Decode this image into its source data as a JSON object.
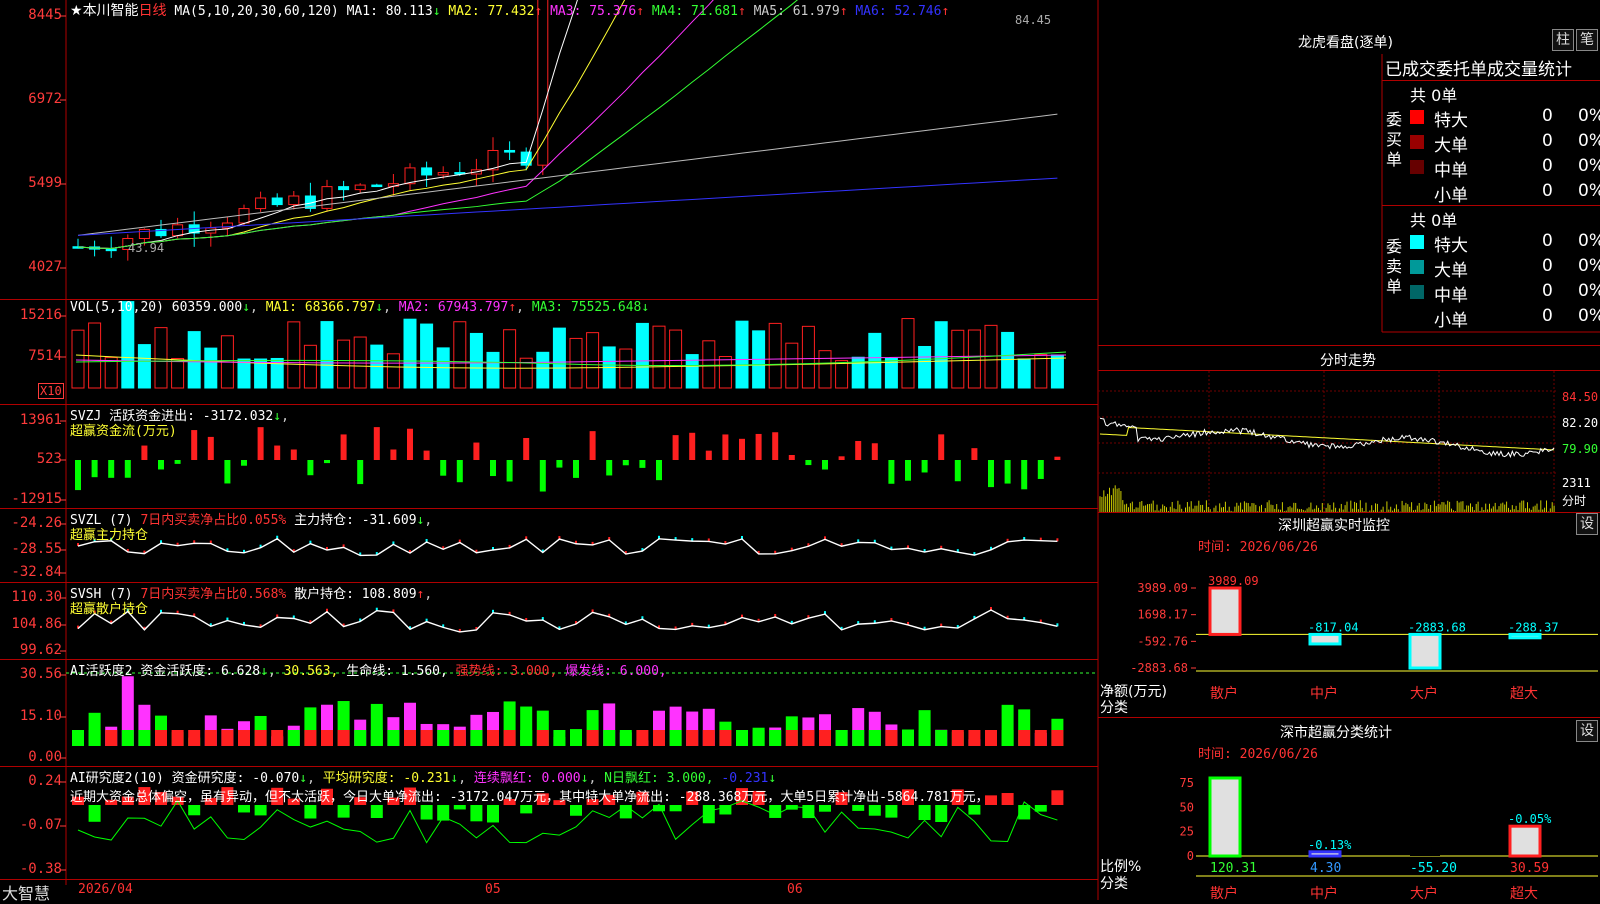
{
  "app_name": "大智慧",
  "stock": {
    "name": "本川智能",
    "period": "日线"
  },
  "main_panel": {
    "ma_header": "MA(5,10,20,30,60,120)",
    "ma": [
      {
        "label": "MA1: 80.113",
        "arrow": "↓",
        "color": "#ffffff"
      },
      {
        "label": "MA2: 77.432",
        "arrow": "↑",
        "color": "#ffff33"
      },
      {
        "label": "MA3: 75.376",
        "arrow": "↑",
        "color": "#ff33ff"
      },
      {
        "label": "MA4: 71.681",
        "arrow": "↑",
        "color": "#33ff33"
      },
      {
        "label": "MA5: 61.979",
        "arrow": "↑",
        "color": "#cccccc"
      },
      {
        "label": "MA6: 52.746",
        "arrow": "↑",
        "color": "#3333ff"
      }
    ],
    "y_ticks": [
      "8445",
      "6972",
      "5499",
      "4027"
    ],
    "high_mark": "84.45",
    "low_mark": "43.94"
  },
  "vol_panel": {
    "header": "VOL(5,10,20)",
    "value": "60359.000",
    "ma1": "MA1: 68366.797",
    "ma2": "MA2: 67943.797",
    "ma3": "MA3: 75525.648",
    "y_ticks": [
      "15216",
      "7514"
    ],
    "unit": "X10"
  },
  "svzj_panel": {
    "header": "SVZJ",
    "text": "活跃资金进出: -3172.032",
    "subtitle": "超赢资金流(万元)",
    "y_ticks": [
      "13961",
      "523",
      "-12915"
    ]
  },
  "svzl_panel": {
    "header": "SVZL (7)",
    "text1": "7日内买卖净占比0.055%",
    "text2": "主力持仓: -31.609",
    "subtitle": "超赢主力持仓",
    "y_ticks": [
      "-24.26",
      "-28.55",
      "-32.84"
    ]
  },
  "svsh_panel": {
    "header": "SVSH (7)",
    "text1": "7日内买卖净占比0.568%",
    "text2": "散户持仓: 108.809",
    "subtitle": "超赢散户持仓",
    "y_ticks": [
      "110.30",
      "104.86",
      "99.62"
    ]
  },
  "ai1_panel": {
    "header": "AI活跃度2",
    "t1": "资金活跃度: 6.628",
    "t2": "30.563,",
    "t3": "生命线: 1.560,",
    "t4": "强势线: 3.000,",
    "t5": "爆发线: 6.000,",
    "y_ticks": [
      "30.56",
      "15.10",
      "0.00"
    ]
  },
  "ai2_panel": {
    "header": "AI研究度2(10)",
    "t1": "资金研究度: -0.070",
    "t2": "平均研究度: -0.231",
    "t3": "连续飘红: 0.000",
    "t4": "N日飘红: 3.000,",
    "t5": "-0.231",
    "summary": "近期大资金总体偏空，虽有异动，但不太活跃，今日大单净流出: -3172.047万元，其中特大单净流出: -288.368万元，大单5日累计净出-5864.781万元，",
    "y_ticks": [
      "0.24",
      "-0.07",
      "-0.38"
    ]
  },
  "x_axis": [
    "2026/04",
    "05",
    "06"
  ],
  "right": {
    "lhkp_title": "龙虎看盘(逐单)",
    "btn_zhu": "柱",
    "btn_bi": "笔",
    "order_tabs": "已成交委托单成交量统计",
    "buy_label": "委买单",
    "sell_label": "委卖单",
    "buy_total": "共 0单",
    "sell_total": "共 0单",
    "buy_rows": [
      {
        "name": "特大",
        "val": "0",
        "pct": "0%",
        "color": "#ff0000"
      },
      {
        "name": "大单",
        "val": "0",
        "pct": "0%",
        "color": "#990000"
      },
      {
        "name": "中单",
        "val": "0",
        "pct": "0%",
        "color": "#660000"
      },
      {
        "name": "小单",
        "val": "0",
        "pct": "0%",
        "color": ""
      }
    ],
    "sell_rows": [
      {
        "name": "特大",
        "val": "0",
        "pct": "0%",
        "color": "#00ffff"
      },
      {
        "name": "大单",
        "val": "0",
        "pct": "0%",
        "color": "#009999"
      },
      {
        "name": "中单",
        "val": "0",
        "pct": "0%",
        "color": "#006666"
      },
      {
        "name": "小单",
        "val": "0",
        "pct": "0%",
        "color": ""
      }
    ],
    "fenshi_title": "分时走势",
    "fenshi_y": [
      "84.50",
      "82.20",
      "79.90",
      "2311",
      "分时"
    ],
    "monitor_title": "深圳超赢实时监控",
    "monitor_btn": "设",
    "monitor_time": "时间: 2026/06/26",
    "monitor_y": [
      "3989.09",
      "1698.17",
      "-592.76",
      "-2883.68"
    ],
    "monitor_ylabel": "净额(万元)",
    "monitor_xlabel": "分类",
    "classify_title": "深市超赢分类统计",
    "classify_btn": "设",
    "classify_time": "时间: 2026/06/26",
    "classify_y": [
      "75",
      "50",
      "25",
      "0"
    ],
    "classify_ylabel": "比例%",
    "classify_xlabel": "分类"
  },
  "chart_data": [
    {
      "type": "bar",
      "title": "深圳超赢实时监控",
      "ylabel": "净额(万元)",
      "categories": [
        "散户",
        "中户",
        "大户",
        "超大"
      ],
      "values": [
        3989.09,
        -817.04,
        -2883.68,
        -288.37
      ],
      "ylim": [
        -2883.68,
        3989.09
      ]
    },
    {
      "type": "bar",
      "title": "深市超赢分类统计",
      "ylabel": "比例%",
      "categories": [
        "散户",
        "中户",
        "大户",
        "超大"
      ],
      "values": [
        120.31,
        4.3,
        -55.2,
        30.59
      ],
      "bar_labels": [
        "",
        "-0.13%",
        "",
        "-0.05%"
      ],
      "ylim": [
        0,
        80
      ]
    }
  ]
}
